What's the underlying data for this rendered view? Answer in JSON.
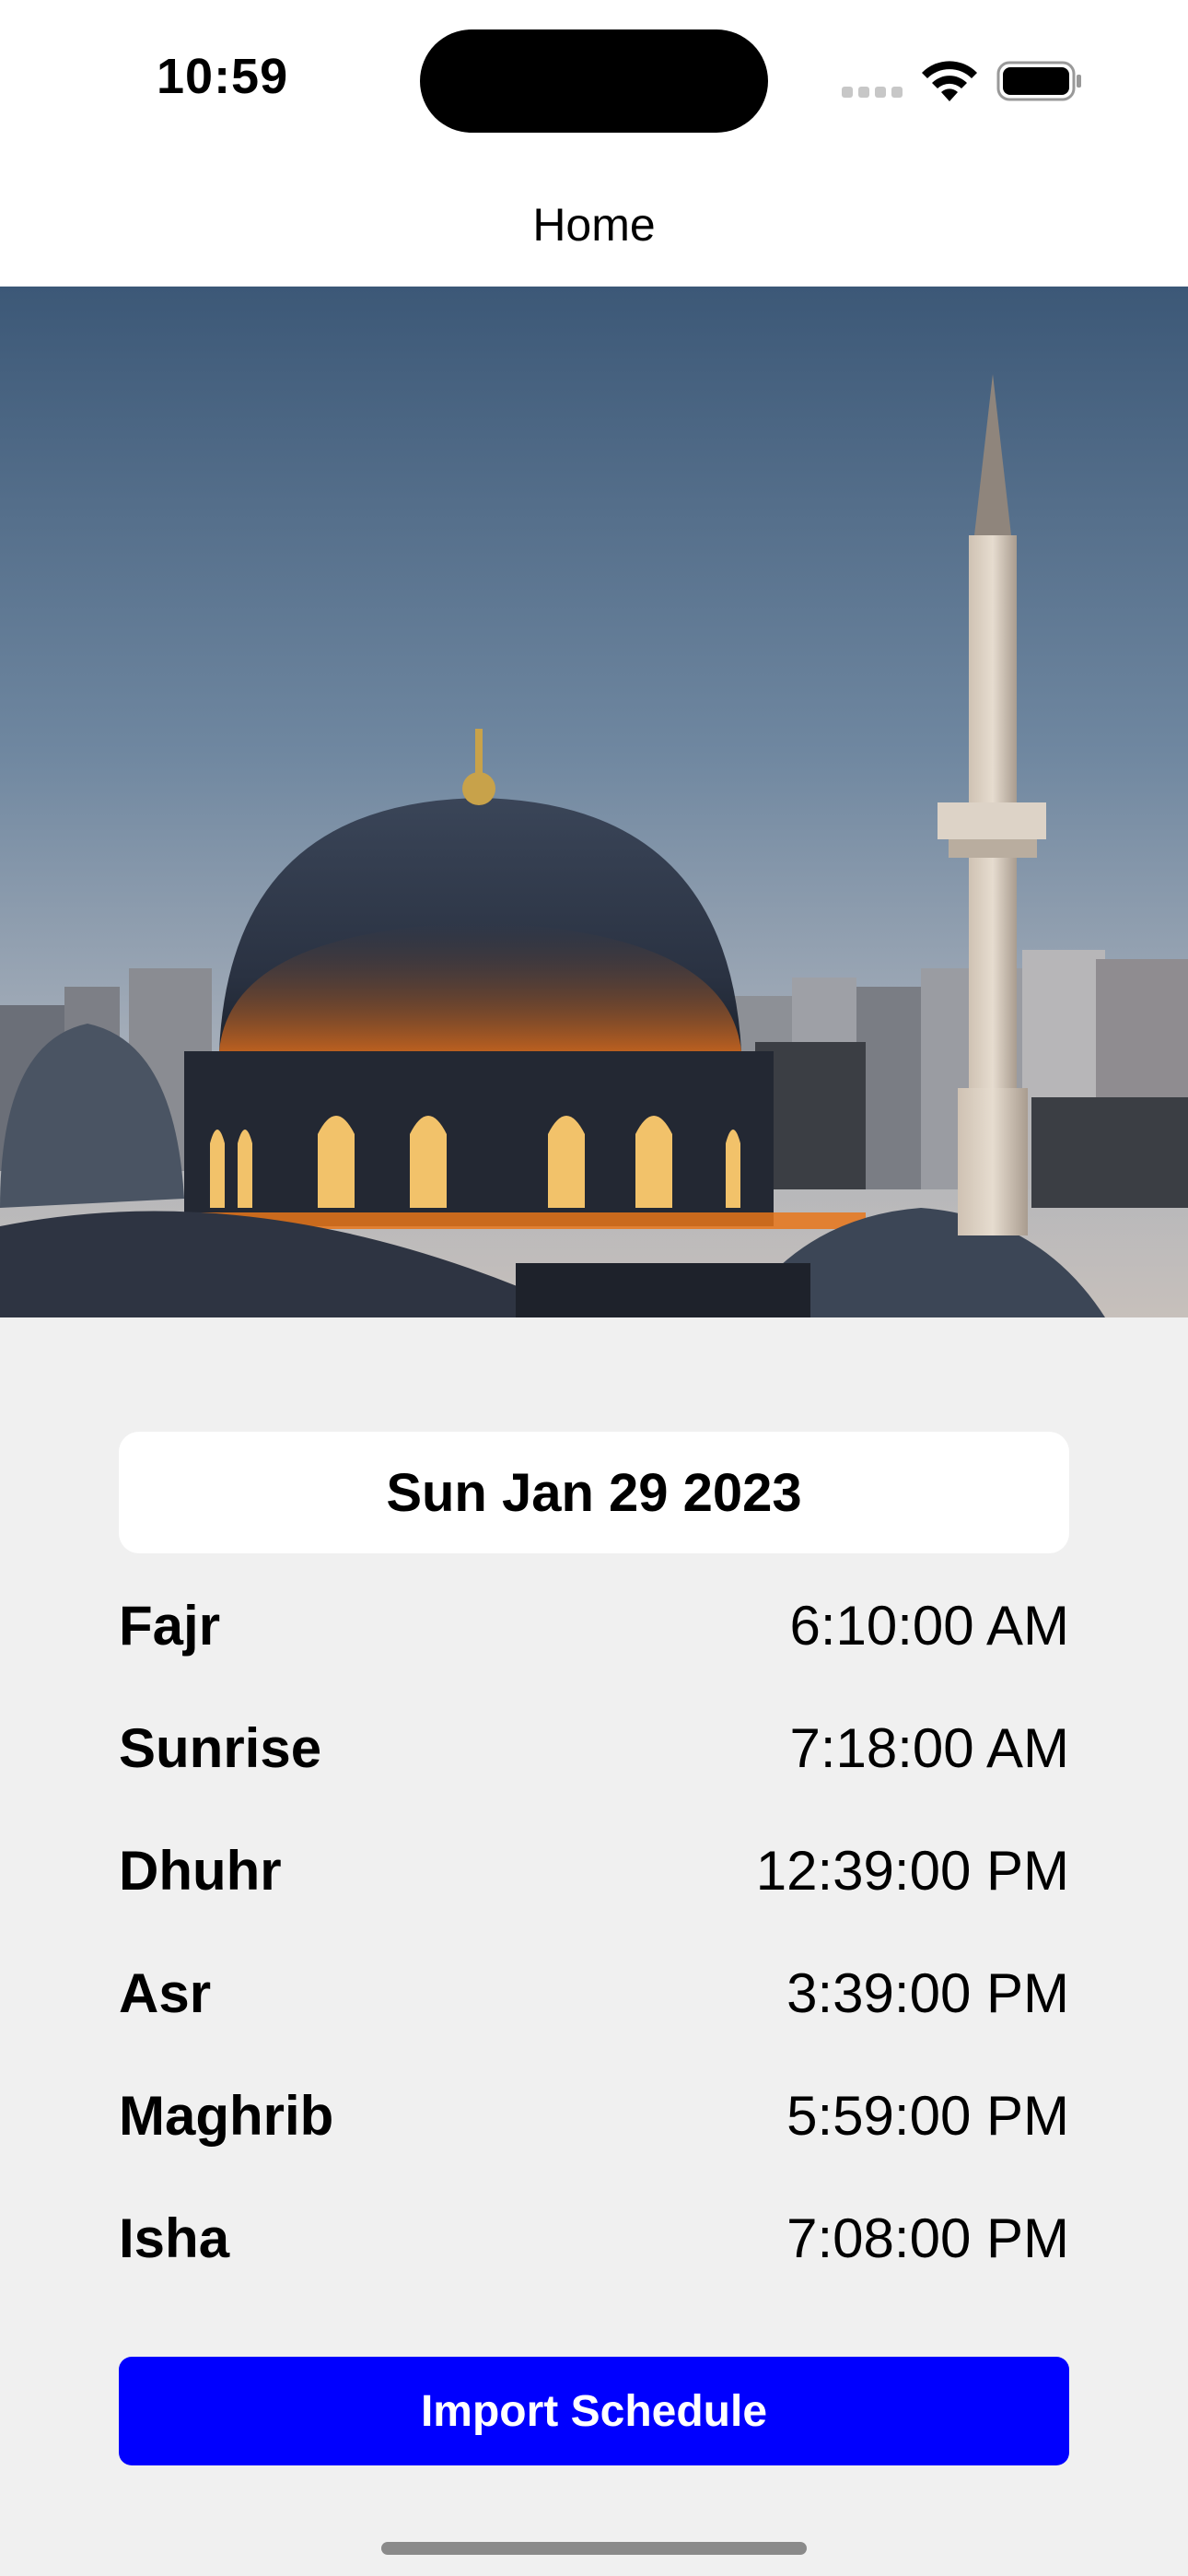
{
  "status_bar": {
    "time": "10:59",
    "icons": [
      "cellular-signal-icon",
      "wifi-icon",
      "battery-icon"
    ]
  },
  "nav": {
    "title": "Home"
  },
  "hero": {
    "image": "mosque-dusk-photo"
  },
  "schedule": {
    "date": "Sun Jan 29 2023",
    "prayers": [
      {
        "name": "Fajr",
        "time": "6:10:00 AM"
      },
      {
        "name": "Sunrise",
        "time": "7:18:00 AM"
      },
      {
        "name": "Dhuhr",
        "time": "12:39:00 PM"
      },
      {
        "name": "Asr",
        "time": "3:39:00 PM"
      },
      {
        "name": "Maghrib",
        "time": "5:59:00 PM"
      },
      {
        "name": "Isha",
        "time": "7:08:00 PM"
      }
    ]
  },
  "actions": {
    "import_label": "Import Schedule"
  },
  "colors": {
    "accent": "#0000ff",
    "background": "#f0f0f0",
    "card": "#ffffff"
  }
}
